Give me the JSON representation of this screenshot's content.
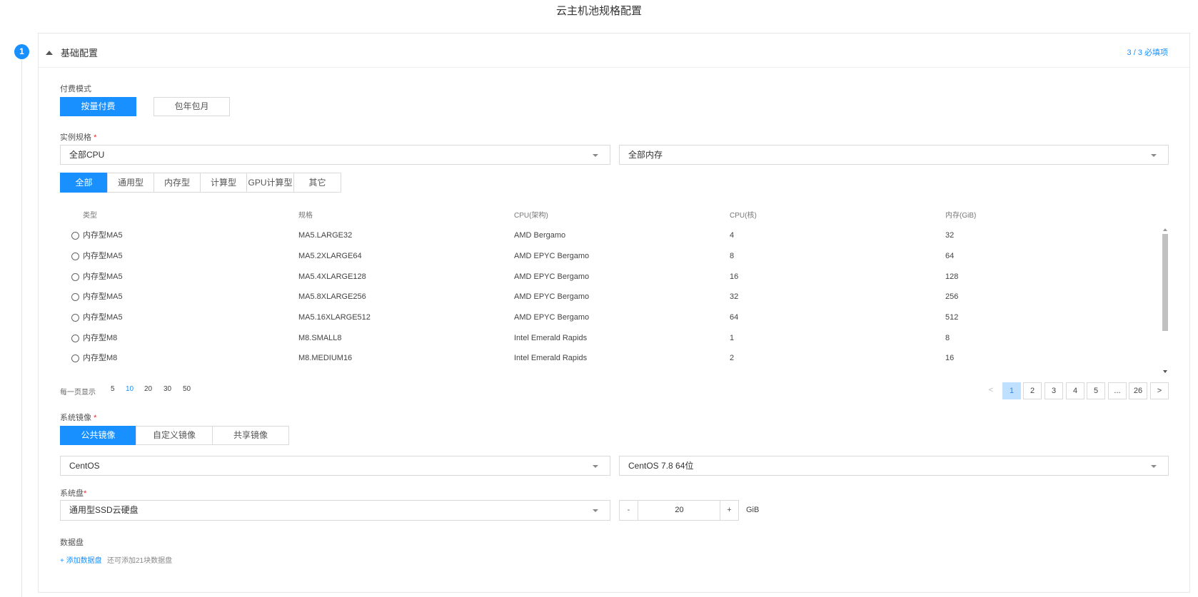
{
  "page": {
    "title": "云主机池规格配置"
  },
  "step": {
    "number": "1"
  },
  "section": {
    "title": "基础配置",
    "required_count": "3 / 3 必填项"
  },
  "billing": {
    "label": "付费模式",
    "options": [
      "按量付费",
      "包年包月"
    ],
    "selected": "按量付费"
  },
  "instance": {
    "label": "实例规格",
    "required_mark": "*",
    "cpu_filter": "全部CPU",
    "memory_filter": "全部内存",
    "tabs": [
      "全部",
      "通用型",
      "内存型",
      "计算型",
      "GPU计算型",
      "其它"
    ],
    "selected_tab": "全部",
    "columns": [
      "类型",
      "规格",
      "CPU(架构)",
      "CPU(核)",
      "内存(GiB)"
    ],
    "rows": [
      [
        "内存型MA5",
        "MA5.LARGE32",
        "AMD Bergamo",
        "4",
        "32"
      ],
      [
        "内存型MA5",
        "MA5.2XLARGE64",
        "AMD EPYC Bergamo",
        "8",
        "64"
      ],
      [
        "内存型MA5",
        "MA5.4XLARGE128",
        "AMD EPYC Bergamo",
        "16",
        "128"
      ],
      [
        "内存型MA5",
        "MA5.8XLARGE256",
        "AMD EPYC Bergamo",
        "32",
        "256"
      ],
      [
        "内存型MA5",
        "MA5.16XLARGE512",
        "AMD EPYC Bergamo",
        "64",
        "512"
      ],
      [
        "内存型M8",
        "M8.SMALL8",
        "Intel Emerald Rapids",
        "1",
        "8"
      ],
      [
        "内存型M8",
        "M8.MEDIUM16",
        "Intel Emerald Rapids",
        "2",
        "16"
      ]
    ]
  },
  "pagination": {
    "per_page_label": "每一页显示",
    "per_page_options": [
      "5",
      "10",
      "20",
      "30",
      "50"
    ],
    "per_page_selected": "10",
    "prev": "<",
    "next": ">",
    "pages": [
      "1",
      "2",
      "3",
      "4",
      "5",
      "...",
      "26"
    ],
    "current": "1"
  },
  "image": {
    "label": "系统镜像",
    "required_mark": "*",
    "tabs": [
      "公共镜像",
      "自定义镜像",
      "共享镜像"
    ],
    "selected_tab": "公共镜像",
    "os": "CentOS",
    "version": "CentOS 7.8 64位"
  },
  "system_disk": {
    "label": "系统盘",
    "required_mark": "*",
    "type": "通用型SSD云硬盘",
    "minus": "-",
    "plus": "+",
    "size": "20",
    "unit": "GiB"
  },
  "data_disk": {
    "label": "数据盘",
    "add_label": "+ 添加数据盘",
    "hint": "还可添加21块数据盘"
  },
  "colors": {
    "primary": "#1890ff",
    "required": "#f5222d",
    "border": "#d9d9d9"
  }
}
